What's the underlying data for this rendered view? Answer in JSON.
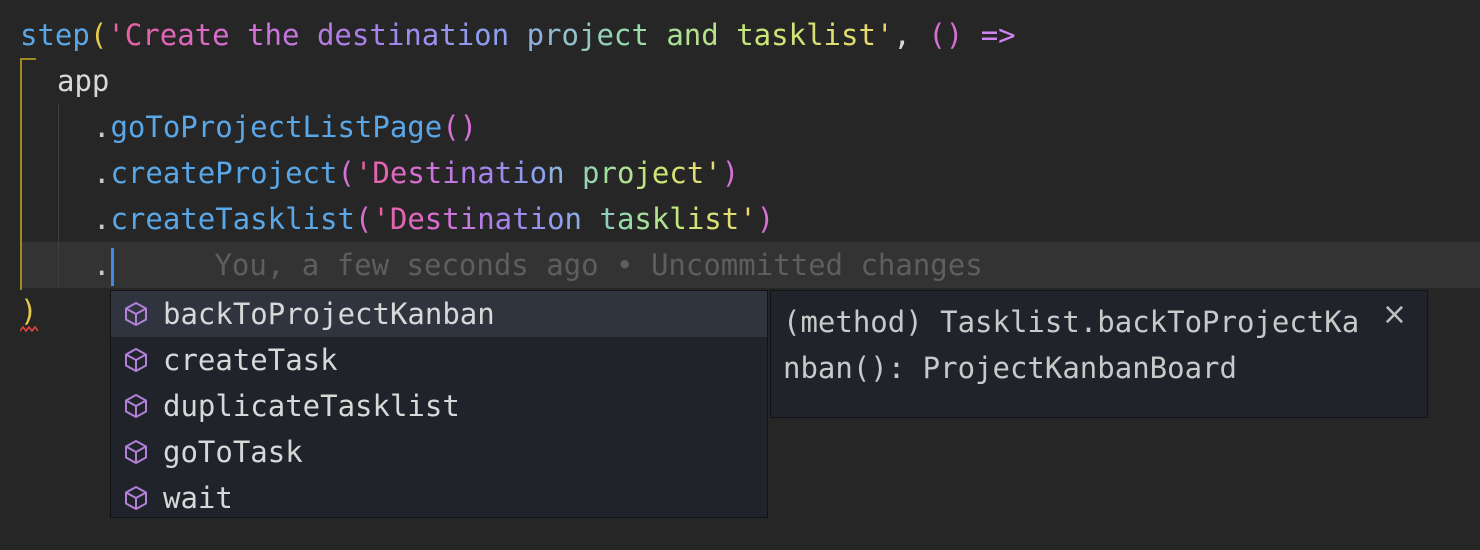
{
  "colors": {
    "background": "#262626",
    "keyword_fn": "#5aa7e8",
    "bracket_gold": "#e6c84a",
    "bracket_purple": "#d670d6",
    "cursor": "#3d8ce6",
    "blame": "#5e5e5e",
    "suggest_bg": "#20232a",
    "suggest_selected": "#2f343f",
    "method_icon": "#b180d7"
  },
  "code": {
    "line1": {
      "fn": "step",
      "open": "(",
      "string": "'Create the destination project and tasklist'",
      "comma": ", ",
      "params": "()",
      "arrow": " =>"
    },
    "line2": {
      "text": "app"
    },
    "line3": {
      "dot": ".",
      "method": "goToProjectListPage",
      "args": "()"
    },
    "line4": {
      "dot": ".",
      "method": "createProject",
      "open": "(",
      "string": "'Destination project'",
      "close": ")"
    },
    "line5": {
      "dot": ".",
      "method": "createTasklist",
      "open": "(",
      "string": "'Destination tasklist'",
      "close": ")"
    },
    "line6": {
      "dot": ".",
      "blame": "You, a few seconds ago • Uncommitted changes"
    },
    "line7": {
      "close": ")"
    }
  },
  "suggestions": {
    "items": [
      {
        "label": "backToProjectKanban",
        "icon": "method-cube-icon",
        "selected": true
      },
      {
        "label": "createTask",
        "icon": "method-cube-icon",
        "selected": false
      },
      {
        "label": "duplicateTasklist",
        "icon": "method-cube-icon",
        "selected": false
      },
      {
        "label": "goToTask",
        "icon": "method-cube-icon",
        "selected": false
      },
      {
        "label": "wait",
        "icon": "method-cube-icon",
        "selected": false
      }
    ]
  },
  "details": {
    "signature": "(method) Tasklist.backToProjectKanban(): ProjectKanbanBoard",
    "close_label": "×"
  }
}
